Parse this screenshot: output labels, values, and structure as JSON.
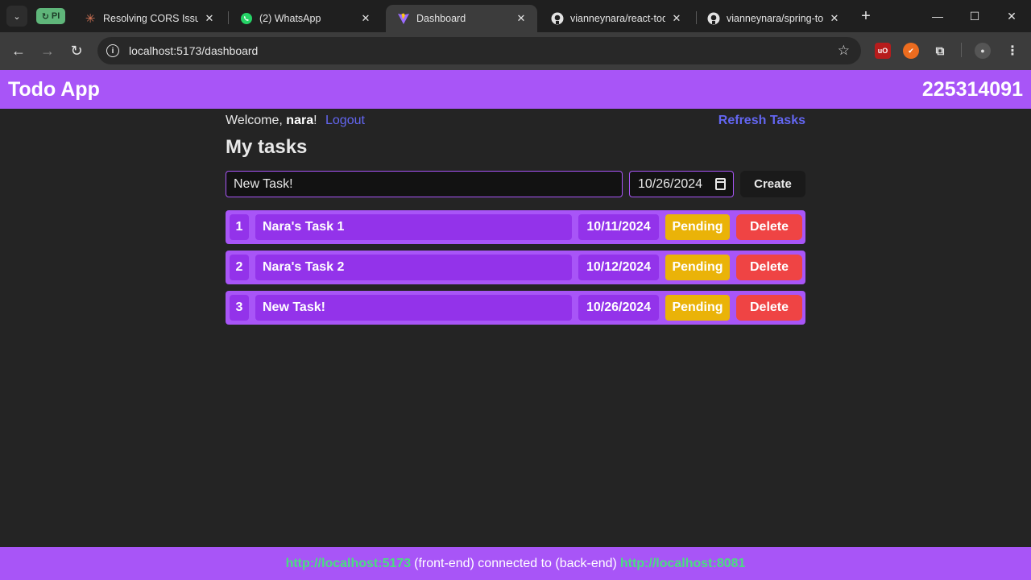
{
  "browser": {
    "pinned_tab_label": "PI",
    "tabs": [
      {
        "title": "Resolving CORS Issues"
      },
      {
        "title": "(2) WhatsApp"
      },
      {
        "title": "Dashboard"
      },
      {
        "title": "vianneynara/react-todo"
      },
      {
        "title": "vianneynara/spring-todo"
      }
    ],
    "url": "localhost:5173/dashboard"
  },
  "app": {
    "title": "Todo App",
    "user_id": "225314091",
    "welcome_prefix": "Welcome,",
    "username": "nara",
    "welcome_suffix": "!",
    "logout_label": "Logout",
    "refresh_label": "Refresh Tasks",
    "page_title": "My tasks",
    "new_task_value": "New Task!",
    "new_task_date": "10/26/2024",
    "create_label": "Create",
    "tasks": [
      {
        "number": "1",
        "title": "Nara's Task 1",
        "date": "10/11/2024",
        "status": "Pending",
        "delete_label": "Delete"
      },
      {
        "number": "2",
        "title": "Nara's Task 2",
        "date": "10/12/2024",
        "status": "Pending",
        "delete_label": "Delete"
      },
      {
        "number": "3",
        "title": "New Task!",
        "date": "10/26/2024",
        "status": "Pending",
        "delete_label": "Delete"
      }
    ],
    "footer": {
      "frontend_url": "http://localhost:5173",
      "middle_text": "(front-end) connected to (back-end)",
      "backend_url": "http://localhost:8081"
    }
  },
  "colors": {
    "accent": "#a855f7",
    "cell": "#9333ea",
    "pending": "#eab308",
    "delete": "#ef4444",
    "link": "#6366f1",
    "footer_link": "#4ade80"
  },
  "icons": [
    "tab-search-icon",
    "claude-icon",
    "whatsapp-icon",
    "vite-icon",
    "github-icon",
    "back-icon",
    "forward-icon",
    "reload-icon",
    "info-icon",
    "star-icon",
    "extensions-icon",
    "calendar-icon"
  ]
}
